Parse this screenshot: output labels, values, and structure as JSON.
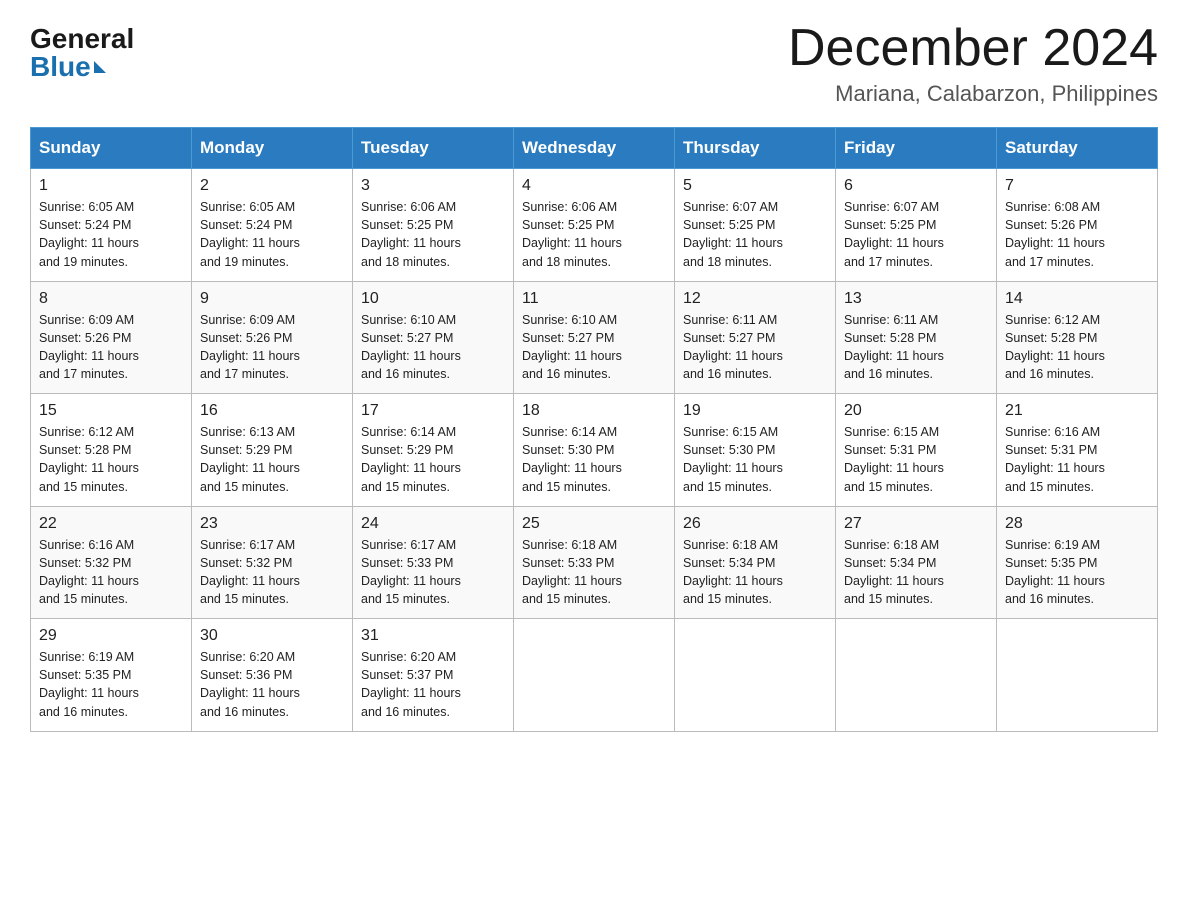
{
  "header": {
    "logo_general": "General",
    "logo_blue": "Blue",
    "month_title": "December 2024",
    "location": "Mariana, Calabarzon, Philippines"
  },
  "weekdays": [
    "Sunday",
    "Monday",
    "Tuesday",
    "Wednesday",
    "Thursday",
    "Friday",
    "Saturday"
  ],
  "weeks": [
    [
      {
        "day": "1",
        "sunrise": "6:05 AM",
        "sunset": "5:24 PM",
        "daylight": "11 hours and 19 minutes."
      },
      {
        "day": "2",
        "sunrise": "6:05 AM",
        "sunset": "5:24 PM",
        "daylight": "11 hours and 19 minutes."
      },
      {
        "day": "3",
        "sunrise": "6:06 AM",
        "sunset": "5:25 PM",
        "daylight": "11 hours and 18 minutes."
      },
      {
        "day": "4",
        "sunrise": "6:06 AM",
        "sunset": "5:25 PM",
        "daylight": "11 hours and 18 minutes."
      },
      {
        "day": "5",
        "sunrise": "6:07 AM",
        "sunset": "5:25 PM",
        "daylight": "11 hours and 18 minutes."
      },
      {
        "day": "6",
        "sunrise": "6:07 AM",
        "sunset": "5:25 PM",
        "daylight": "11 hours and 17 minutes."
      },
      {
        "day": "7",
        "sunrise": "6:08 AM",
        "sunset": "5:26 PM",
        "daylight": "11 hours and 17 minutes."
      }
    ],
    [
      {
        "day": "8",
        "sunrise": "6:09 AM",
        "sunset": "5:26 PM",
        "daylight": "11 hours and 17 minutes."
      },
      {
        "day": "9",
        "sunrise": "6:09 AM",
        "sunset": "5:26 PM",
        "daylight": "11 hours and 17 minutes."
      },
      {
        "day": "10",
        "sunrise": "6:10 AM",
        "sunset": "5:27 PM",
        "daylight": "11 hours and 16 minutes."
      },
      {
        "day": "11",
        "sunrise": "6:10 AM",
        "sunset": "5:27 PM",
        "daylight": "11 hours and 16 minutes."
      },
      {
        "day": "12",
        "sunrise": "6:11 AM",
        "sunset": "5:27 PM",
        "daylight": "11 hours and 16 minutes."
      },
      {
        "day": "13",
        "sunrise": "6:11 AM",
        "sunset": "5:28 PM",
        "daylight": "11 hours and 16 minutes."
      },
      {
        "day": "14",
        "sunrise": "6:12 AM",
        "sunset": "5:28 PM",
        "daylight": "11 hours and 16 minutes."
      }
    ],
    [
      {
        "day": "15",
        "sunrise": "6:12 AM",
        "sunset": "5:28 PM",
        "daylight": "11 hours and 15 minutes."
      },
      {
        "day": "16",
        "sunrise": "6:13 AM",
        "sunset": "5:29 PM",
        "daylight": "11 hours and 15 minutes."
      },
      {
        "day": "17",
        "sunrise": "6:14 AM",
        "sunset": "5:29 PM",
        "daylight": "11 hours and 15 minutes."
      },
      {
        "day": "18",
        "sunrise": "6:14 AM",
        "sunset": "5:30 PM",
        "daylight": "11 hours and 15 minutes."
      },
      {
        "day": "19",
        "sunrise": "6:15 AM",
        "sunset": "5:30 PM",
        "daylight": "11 hours and 15 minutes."
      },
      {
        "day": "20",
        "sunrise": "6:15 AM",
        "sunset": "5:31 PM",
        "daylight": "11 hours and 15 minutes."
      },
      {
        "day": "21",
        "sunrise": "6:16 AM",
        "sunset": "5:31 PM",
        "daylight": "11 hours and 15 minutes."
      }
    ],
    [
      {
        "day": "22",
        "sunrise": "6:16 AM",
        "sunset": "5:32 PM",
        "daylight": "11 hours and 15 minutes."
      },
      {
        "day": "23",
        "sunrise": "6:17 AM",
        "sunset": "5:32 PM",
        "daylight": "11 hours and 15 minutes."
      },
      {
        "day": "24",
        "sunrise": "6:17 AM",
        "sunset": "5:33 PM",
        "daylight": "11 hours and 15 minutes."
      },
      {
        "day": "25",
        "sunrise": "6:18 AM",
        "sunset": "5:33 PM",
        "daylight": "11 hours and 15 minutes."
      },
      {
        "day": "26",
        "sunrise": "6:18 AM",
        "sunset": "5:34 PM",
        "daylight": "11 hours and 15 minutes."
      },
      {
        "day": "27",
        "sunrise": "6:18 AM",
        "sunset": "5:34 PM",
        "daylight": "11 hours and 15 minutes."
      },
      {
        "day": "28",
        "sunrise": "6:19 AM",
        "sunset": "5:35 PM",
        "daylight": "11 hours and 16 minutes."
      }
    ],
    [
      {
        "day": "29",
        "sunrise": "6:19 AM",
        "sunset": "5:35 PM",
        "daylight": "11 hours and 16 minutes."
      },
      {
        "day": "30",
        "sunrise": "6:20 AM",
        "sunset": "5:36 PM",
        "daylight": "11 hours and 16 minutes."
      },
      {
        "day": "31",
        "sunrise": "6:20 AM",
        "sunset": "5:37 PM",
        "daylight": "11 hours and 16 minutes."
      },
      null,
      null,
      null,
      null
    ]
  ],
  "labels": {
    "sunrise": "Sunrise:",
    "sunset": "Sunset:",
    "daylight": "Daylight:"
  }
}
